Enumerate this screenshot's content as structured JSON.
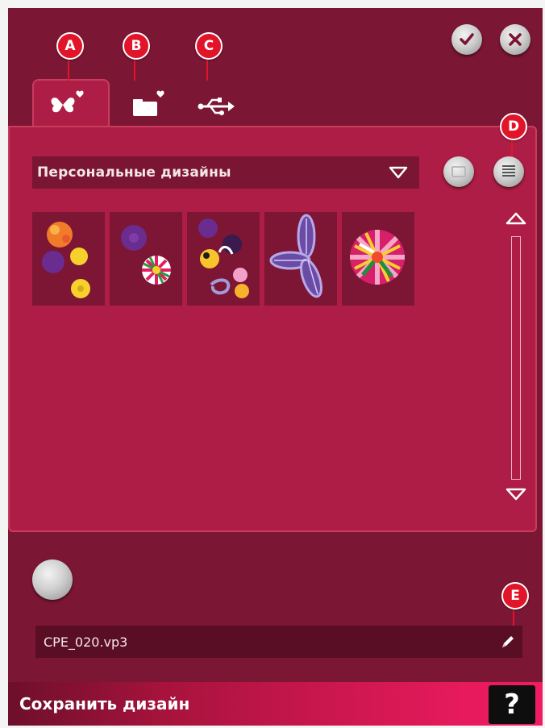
{
  "callouts": {
    "a": "A",
    "b": "B",
    "c": "C",
    "d": "D",
    "e": "E"
  },
  "tabs": [
    {
      "name": "personal-designs",
      "icon": "butterfly-heart-icon",
      "active": true
    },
    {
      "name": "personal-files",
      "icon": "folder-heart-icon",
      "active": false
    },
    {
      "name": "usb",
      "icon": "usb-icon",
      "active": false
    }
  ],
  "top_buttons": {
    "ok_icon": "checkmark-icon",
    "cancel_icon": "close-icon"
  },
  "dropdown": {
    "selected": "Персональные дизайны",
    "icon": "triangle-down-icon"
  },
  "view_buttons": {
    "thumbnail_icon": "blank-round-icon",
    "list_icon": "list-view-icon"
  },
  "thumbnails": [
    {
      "name": "flowers-orange-purple-yellow"
    },
    {
      "name": "flower-purple-pompom"
    },
    {
      "name": "flowers-mixed-ribbon"
    },
    {
      "name": "purple-petals"
    },
    {
      "name": "pompom-multicolor"
    }
  ],
  "scroll": {
    "up_icon": "triangle-up-icon",
    "down_icon": "triangle-down-icon"
  },
  "filename": {
    "value": "CPE_020.vp3",
    "edit_icon": "pencil-icon"
  },
  "footer": {
    "title": "Сохранить дизайн",
    "help_label": "?"
  },
  "colors": {
    "background": "#7c1635",
    "panel": "#ad1d45",
    "callout": "#e2142a",
    "footer_accent": "#f01c62"
  }
}
